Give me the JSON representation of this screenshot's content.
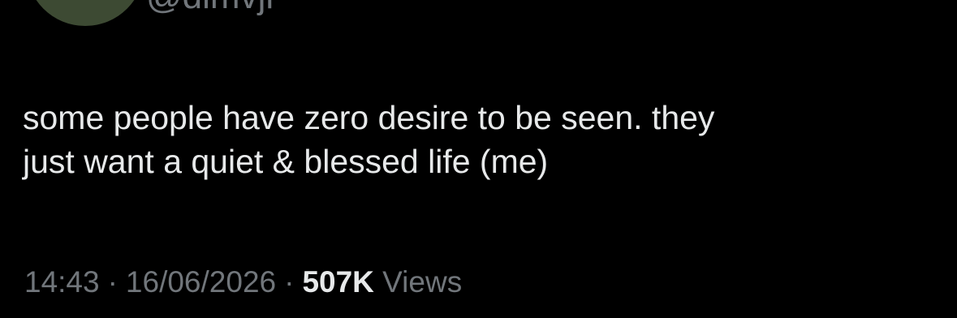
{
  "author": {
    "handle": "@dimvjl"
  },
  "tweet": {
    "lines": [
      "some people have zero desire to be seen. they",
      "just want a quiet & blessed life (me)"
    ]
  },
  "meta": {
    "time": "14:43",
    "separator": "·",
    "date": "16/06/2026",
    "views_count": "507K",
    "views_label": "Views"
  },
  "colors": {
    "background": "#000000",
    "text_primary": "#e7e9ea",
    "text_secondary": "#71767b",
    "avatar": "#3d4a33"
  }
}
